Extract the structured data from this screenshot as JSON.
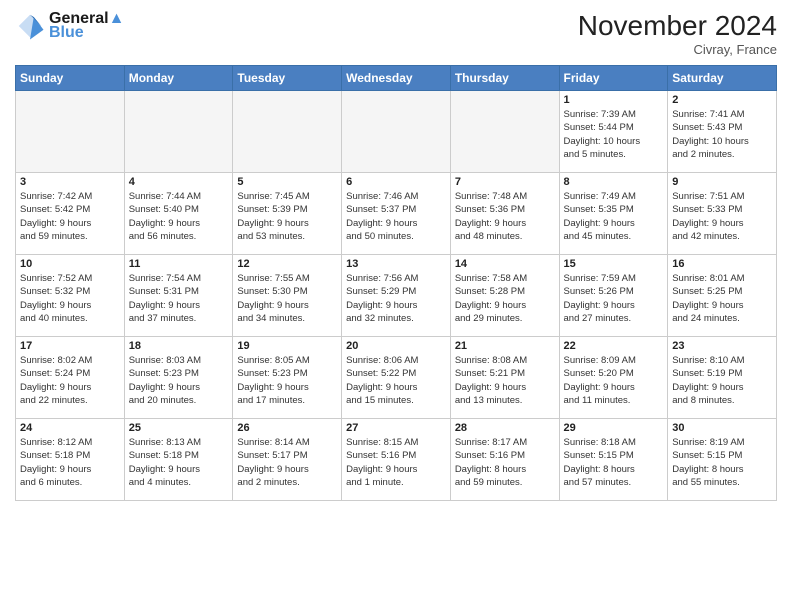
{
  "header": {
    "logo_line1": "General",
    "logo_line2": "Blue",
    "month": "November 2024",
    "location": "Civray, France"
  },
  "weekdays": [
    "Sunday",
    "Monday",
    "Tuesday",
    "Wednesday",
    "Thursday",
    "Friday",
    "Saturday"
  ],
  "weeks": [
    [
      {
        "day": "",
        "info": ""
      },
      {
        "day": "",
        "info": ""
      },
      {
        "day": "",
        "info": ""
      },
      {
        "day": "",
        "info": ""
      },
      {
        "day": "",
        "info": ""
      },
      {
        "day": "1",
        "info": "Sunrise: 7:39 AM\nSunset: 5:44 PM\nDaylight: 10 hours\nand 5 minutes."
      },
      {
        "day": "2",
        "info": "Sunrise: 7:41 AM\nSunset: 5:43 PM\nDaylight: 10 hours\nand 2 minutes."
      }
    ],
    [
      {
        "day": "3",
        "info": "Sunrise: 7:42 AM\nSunset: 5:42 PM\nDaylight: 9 hours\nand 59 minutes."
      },
      {
        "day": "4",
        "info": "Sunrise: 7:44 AM\nSunset: 5:40 PM\nDaylight: 9 hours\nand 56 minutes."
      },
      {
        "day": "5",
        "info": "Sunrise: 7:45 AM\nSunset: 5:39 PM\nDaylight: 9 hours\nand 53 minutes."
      },
      {
        "day": "6",
        "info": "Sunrise: 7:46 AM\nSunset: 5:37 PM\nDaylight: 9 hours\nand 50 minutes."
      },
      {
        "day": "7",
        "info": "Sunrise: 7:48 AM\nSunset: 5:36 PM\nDaylight: 9 hours\nand 48 minutes."
      },
      {
        "day": "8",
        "info": "Sunrise: 7:49 AM\nSunset: 5:35 PM\nDaylight: 9 hours\nand 45 minutes."
      },
      {
        "day": "9",
        "info": "Sunrise: 7:51 AM\nSunset: 5:33 PM\nDaylight: 9 hours\nand 42 minutes."
      }
    ],
    [
      {
        "day": "10",
        "info": "Sunrise: 7:52 AM\nSunset: 5:32 PM\nDaylight: 9 hours\nand 40 minutes."
      },
      {
        "day": "11",
        "info": "Sunrise: 7:54 AM\nSunset: 5:31 PM\nDaylight: 9 hours\nand 37 minutes."
      },
      {
        "day": "12",
        "info": "Sunrise: 7:55 AM\nSunset: 5:30 PM\nDaylight: 9 hours\nand 34 minutes."
      },
      {
        "day": "13",
        "info": "Sunrise: 7:56 AM\nSunset: 5:29 PM\nDaylight: 9 hours\nand 32 minutes."
      },
      {
        "day": "14",
        "info": "Sunrise: 7:58 AM\nSunset: 5:28 PM\nDaylight: 9 hours\nand 29 minutes."
      },
      {
        "day": "15",
        "info": "Sunrise: 7:59 AM\nSunset: 5:26 PM\nDaylight: 9 hours\nand 27 minutes."
      },
      {
        "day": "16",
        "info": "Sunrise: 8:01 AM\nSunset: 5:25 PM\nDaylight: 9 hours\nand 24 minutes."
      }
    ],
    [
      {
        "day": "17",
        "info": "Sunrise: 8:02 AM\nSunset: 5:24 PM\nDaylight: 9 hours\nand 22 minutes."
      },
      {
        "day": "18",
        "info": "Sunrise: 8:03 AM\nSunset: 5:23 PM\nDaylight: 9 hours\nand 20 minutes."
      },
      {
        "day": "19",
        "info": "Sunrise: 8:05 AM\nSunset: 5:23 PM\nDaylight: 9 hours\nand 17 minutes."
      },
      {
        "day": "20",
        "info": "Sunrise: 8:06 AM\nSunset: 5:22 PM\nDaylight: 9 hours\nand 15 minutes."
      },
      {
        "day": "21",
        "info": "Sunrise: 8:08 AM\nSunset: 5:21 PM\nDaylight: 9 hours\nand 13 minutes."
      },
      {
        "day": "22",
        "info": "Sunrise: 8:09 AM\nSunset: 5:20 PM\nDaylight: 9 hours\nand 11 minutes."
      },
      {
        "day": "23",
        "info": "Sunrise: 8:10 AM\nSunset: 5:19 PM\nDaylight: 9 hours\nand 8 minutes."
      }
    ],
    [
      {
        "day": "24",
        "info": "Sunrise: 8:12 AM\nSunset: 5:18 PM\nDaylight: 9 hours\nand 6 minutes."
      },
      {
        "day": "25",
        "info": "Sunrise: 8:13 AM\nSunset: 5:18 PM\nDaylight: 9 hours\nand 4 minutes."
      },
      {
        "day": "26",
        "info": "Sunrise: 8:14 AM\nSunset: 5:17 PM\nDaylight: 9 hours\nand 2 minutes."
      },
      {
        "day": "27",
        "info": "Sunrise: 8:15 AM\nSunset: 5:16 PM\nDaylight: 9 hours\nand 1 minute."
      },
      {
        "day": "28",
        "info": "Sunrise: 8:17 AM\nSunset: 5:16 PM\nDaylight: 8 hours\nand 59 minutes."
      },
      {
        "day": "29",
        "info": "Sunrise: 8:18 AM\nSunset: 5:15 PM\nDaylight: 8 hours\nand 57 minutes."
      },
      {
        "day": "30",
        "info": "Sunrise: 8:19 AM\nSunset: 5:15 PM\nDaylight: 8 hours\nand 55 minutes."
      }
    ]
  ]
}
